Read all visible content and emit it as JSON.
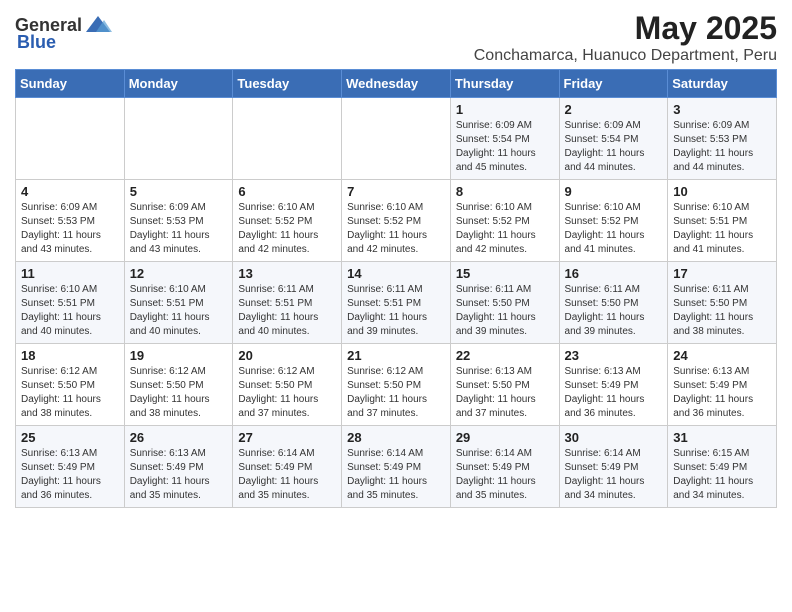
{
  "header": {
    "logo_general": "General",
    "logo_blue": "Blue",
    "title": "May 2025",
    "subtitle": "Conchamarca, Huanuco Department, Peru"
  },
  "calendar": {
    "weekdays": [
      "Sunday",
      "Monday",
      "Tuesday",
      "Wednesday",
      "Thursday",
      "Friday",
      "Saturday"
    ],
    "weeks": [
      [
        {
          "day": "",
          "info": ""
        },
        {
          "day": "",
          "info": ""
        },
        {
          "day": "",
          "info": ""
        },
        {
          "day": "",
          "info": ""
        },
        {
          "day": "1",
          "info": "Sunrise: 6:09 AM\nSunset: 5:54 PM\nDaylight: 11 hours and 45 minutes."
        },
        {
          "day": "2",
          "info": "Sunrise: 6:09 AM\nSunset: 5:54 PM\nDaylight: 11 hours and 44 minutes."
        },
        {
          "day": "3",
          "info": "Sunrise: 6:09 AM\nSunset: 5:53 PM\nDaylight: 11 hours and 44 minutes."
        }
      ],
      [
        {
          "day": "4",
          "info": "Sunrise: 6:09 AM\nSunset: 5:53 PM\nDaylight: 11 hours and 43 minutes."
        },
        {
          "day": "5",
          "info": "Sunrise: 6:09 AM\nSunset: 5:53 PM\nDaylight: 11 hours and 43 minutes."
        },
        {
          "day": "6",
          "info": "Sunrise: 6:10 AM\nSunset: 5:52 PM\nDaylight: 11 hours and 42 minutes."
        },
        {
          "day": "7",
          "info": "Sunrise: 6:10 AM\nSunset: 5:52 PM\nDaylight: 11 hours and 42 minutes."
        },
        {
          "day": "8",
          "info": "Sunrise: 6:10 AM\nSunset: 5:52 PM\nDaylight: 11 hours and 42 minutes."
        },
        {
          "day": "9",
          "info": "Sunrise: 6:10 AM\nSunset: 5:52 PM\nDaylight: 11 hours and 41 minutes."
        },
        {
          "day": "10",
          "info": "Sunrise: 6:10 AM\nSunset: 5:51 PM\nDaylight: 11 hours and 41 minutes."
        }
      ],
      [
        {
          "day": "11",
          "info": "Sunrise: 6:10 AM\nSunset: 5:51 PM\nDaylight: 11 hours and 40 minutes."
        },
        {
          "day": "12",
          "info": "Sunrise: 6:10 AM\nSunset: 5:51 PM\nDaylight: 11 hours and 40 minutes."
        },
        {
          "day": "13",
          "info": "Sunrise: 6:11 AM\nSunset: 5:51 PM\nDaylight: 11 hours and 40 minutes."
        },
        {
          "day": "14",
          "info": "Sunrise: 6:11 AM\nSunset: 5:51 PM\nDaylight: 11 hours and 39 minutes."
        },
        {
          "day": "15",
          "info": "Sunrise: 6:11 AM\nSunset: 5:50 PM\nDaylight: 11 hours and 39 minutes."
        },
        {
          "day": "16",
          "info": "Sunrise: 6:11 AM\nSunset: 5:50 PM\nDaylight: 11 hours and 39 minutes."
        },
        {
          "day": "17",
          "info": "Sunrise: 6:11 AM\nSunset: 5:50 PM\nDaylight: 11 hours and 38 minutes."
        }
      ],
      [
        {
          "day": "18",
          "info": "Sunrise: 6:12 AM\nSunset: 5:50 PM\nDaylight: 11 hours and 38 minutes."
        },
        {
          "day": "19",
          "info": "Sunrise: 6:12 AM\nSunset: 5:50 PM\nDaylight: 11 hours and 38 minutes."
        },
        {
          "day": "20",
          "info": "Sunrise: 6:12 AM\nSunset: 5:50 PM\nDaylight: 11 hours and 37 minutes."
        },
        {
          "day": "21",
          "info": "Sunrise: 6:12 AM\nSunset: 5:50 PM\nDaylight: 11 hours and 37 minutes."
        },
        {
          "day": "22",
          "info": "Sunrise: 6:13 AM\nSunset: 5:50 PM\nDaylight: 11 hours and 37 minutes."
        },
        {
          "day": "23",
          "info": "Sunrise: 6:13 AM\nSunset: 5:49 PM\nDaylight: 11 hours and 36 minutes."
        },
        {
          "day": "24",
          "info": "Sunrise: 6:13 AM\nSunset: 5:49 PM\nDaylight: 11 hours and 36 minutes."
        }
      ],
      [
        {
          "day": "25",
          "info": "Sunrise: 6:13 AM\nSunset: 5:49 PM\nDaylight: 11 hours and 36 minutes."
        },
        {
          "day": "26",
          "info": "Sunrise: 6:13 AM\nSunset: 5:49 PM\nDaylight: 11 hours and 35 minutes."
        },
        {
          "day": "27",
          "info": "Sunrise: 6:14 AM\nSunset: 5:49 PM\nDaylight: 11 hours and 35 minutes."
        },
        {
          "day": "28",
          "info": "Sunrise: 6:14 AM\nSunset: 5:49 PM\nDaylight: 11 hours and 35 minutes."
        },
        {
          "day": "29",
          "info": "Sunrise: 6:14 AM\nSunset: 5:49 PM\nDaylight: 11 hours and 35 minutes."
        },
        {
          "day": "30",
          "info": "Sunrise: 6:14 AM\nSunset: 5:49 PM\nDaylight: 11 hours and 34 minutes."
        },
        {
          "day": "31",
          "info": "Sunrise: 6:15 AM\nSunset: 5:49 PM\nDaylight: 11 hours and 34 minutes."
        }
      ]
    ]
  }
}
